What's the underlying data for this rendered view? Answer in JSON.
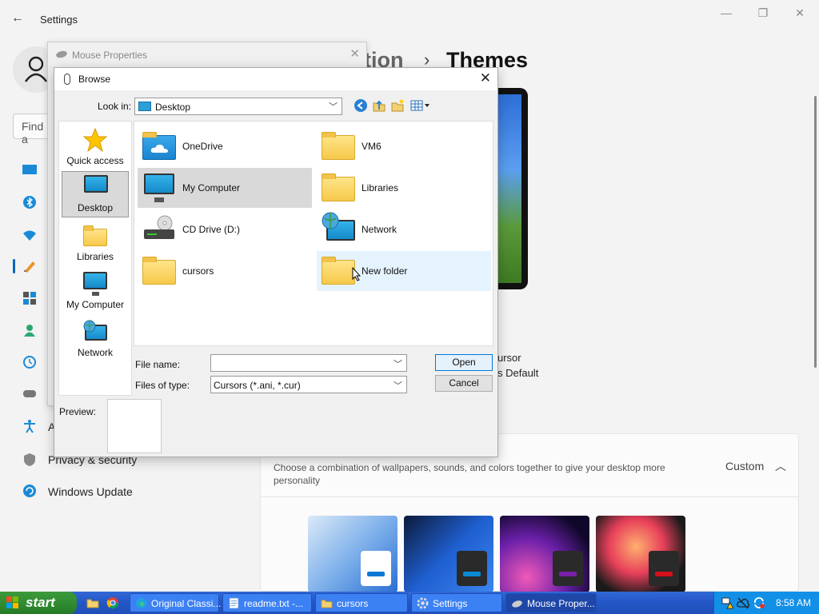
{
  "settings": {
    "title": "Settings",
    "breadcrumb_parent": "ation",
    "breadcrumb_sep": "›",
    "breadcrumb_current": "Themes",
    "find_placeholder": "Find a",
    "nav": [
      {
        "label": "A",
        "icon": "accessibility-icon"
      },
      {
        "label": "Privacy & security",
        "icon": "shield-icon"
      },
      {
        "label": "Windows Update",
        "icon": "update-icon"
      }
    ],
    "cursor_line1": "ursor",
    "cursor_line2": "s Default",
    "theme_desc": "Choose a combination of wallpapers, sounds, and colors together to give your desktop more personality",
    "theme_value": "Custom"
  },
  "mouse_properties": {
    "title": "Mouse Properties"
  },
  "browse": {
    "title": "Browse",
    "look_in_label": "Look in:",
    "look_in_value": "Desktop",
    "places": [
      {
        "label": "Quick access",
        "icon": "star-icon"
      },
      {
        "label": "Desktop",
        "icon": "desktop-icon",
        "selected": true
      },
      {
        "label": "Libraries",
        "icon": "libraries-icon"
      },
      {
        "label": "My Computer",
        "icon": "computer-icon"
      },
      {
        "label": "Network",
        "icon": "network-icon"
      }
    ],
    "files": [
      {
        "label": "OneDrive",
        "icon": "onedrive-icon"
      },
      {
        "label": "VM6",
        "icon": "folder-icon"
      },
      {
        "label": "My Computer",
        "icon": "computer-icon",
        "selected": true
      },
      {
        "label": "Libraries",
        "icon": "libraries-icon"
      },
      {
        "label": "CD Drive (D:)",
        "icon": "cd-drive-icon"
      },
      {
        "label": "Network",
        "icon": "network-icon"
      },
      {
        "label": "cursors",
        "icon": "folder-icon"
      },
      {
        "label": "New folder",
        "icon": "folder-icon",
        "hover": true
      }
    ],
    "file_name_label": "File name:",
    "file_name_value": "",
    "files_of_type_label": "Files of type:",
    "files_of_type_value": "Cursors (*.ani, *.cur)",
    "open_label": "Open",
    "cancel_label": "Cancel",
    "preview_label": "Preview:"
  },
  "taskbar": {
    "start_label": "start",
    "tasks": [
      {
        "label": "Original Classi...",
        "icon": "edge-icon"
      },
      {
        "label": "readme.txt -...",
        "icon": "notepad-icon"
      },
      {
        "label": "cursors",
        "icon": "folder-icon"
      },
      {
        "label": "Settings",
        "icon": "gear-icon"
      },
      {
        "label": "Mouse Proper...",
        "icon": "mouse-icon",
        "active": true
      }
    ],
    "time": "8:58 AM"
  }
}
